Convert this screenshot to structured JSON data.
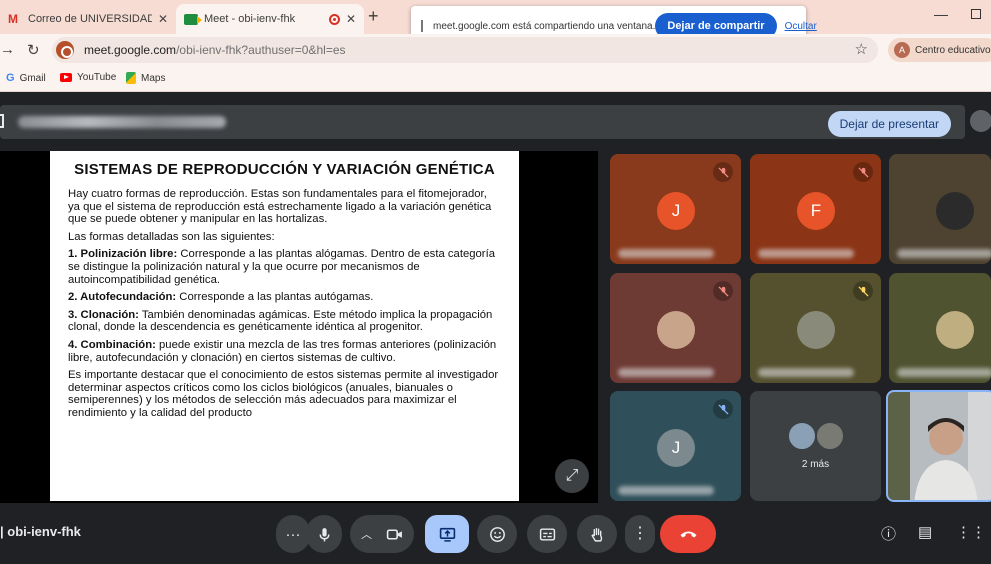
{
  "browser": {
    "tabs": [
      {
        "title": "Correo de UNIVERSIDAD MICH",
        "close": "✕"
      },
      {
        "title": "Meet - obi-ienv-fhk",
        "close": "✕"
      }
    ],
    "new_tab": "+",
    "url_host": "meet.google.com",
    "url_path": "/obi-ienv-fhk?authuser=0&hl=es",
    "profile_initial": "A",
    "profile_name": "Centro educativo",
    "bookmarks": [
      "Gmail",
      "YouTube",
      "Maps"
    ],
    "sharing_message": "meet.google.com está compartiendo una ventana.",
    "stop_sharing_label": "Dejar de compartir",
    "hide_label": "Ocultar"
  },
  "meet": {
    "stop_presenting_label": "Dejar de presentar",
    "meeting_code": "obi-ienv-fhk",
    "more_label": "2 más",
    "colors": {
      "accent": "#1a5fd0",
      "end_call": "#ea4335",
      "present_active": "#a8c7fa"
    }
  },
  "slide": {
    "title": "SISTEMAS DE REPRODUCCIÓN Y VARIACIÓN GENÉTICA",
    "intro": "Hay cuatro formas de reproducción. Estas son fundamentales para el fitomejorador, ya que el sistema de reproducción está estrechamente ligado a la variación genética que se puede obtener y manipular en las hortalizas.",
    "lead": "Las formas detalladas son las siguientes:",
    "items": [
      {
        "label": "1. Polinización libre:",
        "text": " Corresponde a las plantas alógamas. Dentro de esta categoría se distingue la polinización natural y la que ocurre por mecanismos de autoincompatibilidad genética."
      },
      {
        "label": "2. Autofecundación:",
        "text": " Corresponde a las plantas autógamas."
      },
      {
        "label": "3. Clonación:",
        "text": " También denominadas agámicas. Este método implica la propagación clonal, donde la descendencia es genéticamente idéntica al progenitor."
      },
      {
        "label": "4. Combinación:",
        "text": " puede existir una mezcla de las tres formas anteriores (polinización libre, autofecundación y clonación) en ciertos sistemas de cultivo."
      }
    ],
    "closing": "Es importante destacar que el conocimiento de estos sistemas permite al investigador determinar aspectos críticos como los ciclos biológicos (anuales, bianuales o semiperennes) y los métodos de selección más adecuados para maximizar el rendimiento y la calidad del producto"
  },
  "participants": [
    {
      "initial": "J",
      "bg": "#8a3a1c",
      "avatar": "#e8542a"
    },
    {
      "initial": "F",
      "bg": "#8c3416",
      "avatar": "#e8542a"
    },
    {
      "initial": "",
      "bg": "#4e4230",
      "avatar": "#2b2b2b"
    },
    {
      "initial": "",
      "bg": "#6e3a34",
      "avatar": "#c8a48a"
    },
    {
      "initial": "",
      "bg": "#55502e",
      "avatar": "#8a8a7a"
    },
    {
      "initial": "",
      "bg": "#4f5330",
      "avatar": "#bfae80"
    },
    {
      "initial": "J",
      "bg": "#2f4f5a",
      "avatar": "#7c8a90"
    }
  ]
}
